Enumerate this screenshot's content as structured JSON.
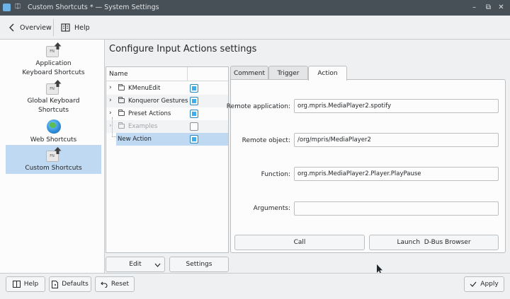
{
  "window": {
    "title": "Custom Shortcuts * — System Settings",
    "pin_glyph": "⎅",
    "minimize_glyph": "–",
    "maximize_glyph": "⧉",
    "close_glyph": "✕"
  },
  "toolbar": {
    "overview_label": "Overview",
    "help_label": "Help"
  },
  "sidebar": {
    "items": [
      {
        "label": "Application Keyboard Shortcuts",
        "icon": "fn-key-icon"
      },
      {
        "label": "Global Keyboard Shortcuts",
        "icon": "fn-key-icon"
      },
      {
        "label": "Web Shortcuts",
        "icon": "globe-icon"
      },
      {
        "label": "Custom Shortcuts",
        "icon": "fn-key-icon",
        "selected": true
      }
    ],
    "fn_key_text": "FN"
  },
  "main": {
    "heading": "Configure Input Actions settings",
    "tree": {
      "column_name": "Name",
      "rows": [
        {
          "label": "KMenuEdit",
          "checked": true
        },
        {
          "label": "Konqueror Gestures",
          "checked": true
        },
        {
          "label": "Preset Actions",
          "checked": true
        },
        {
          "label": "Examples",
          "checked": false,
          "disabled": true
        },
        {
          "label": "New Action",
          "checked": true,
          "selected": true
        }
      ]
    },
    "edit_label": "Edit",
    "settings_label": "Settings",
    "tabs": [
      {
        "label": "Comment"
      },
      {
        "label": "Trigger"
      },
      {
        "label": "Action",
        "active": true
      }
    ],
    "action": {
      "remote_app_label": "Remote application:",
      "remote_app_value": "org.mpris.MediaPlayer2.spotify",
      "remote_obj_label": "Remote object:",
      "remote_obj_value": "/org/mpris/MediaPlayer2",
      "function_label": "Function:",
      "function_value": "org.mpris.MediaPlayer2.Player.PlayPause",
      "arguments_label": "Arguments:",
      "arguments_value": "",
      "call_label": "Call",
      "launch_label": "Launch  D-Bus Browser"
    }
  },
  "footer": {
    "help_label": "Help",
    "defaults_label": "Defaults",
    "reset_label": "Reset",
    "apply_label": "Apply"
  },
  "colors": {
    "selection": "#bfd9f2",
    "checkbox": "#3daee9",
    "titlebar": "#475057"
  }
}
